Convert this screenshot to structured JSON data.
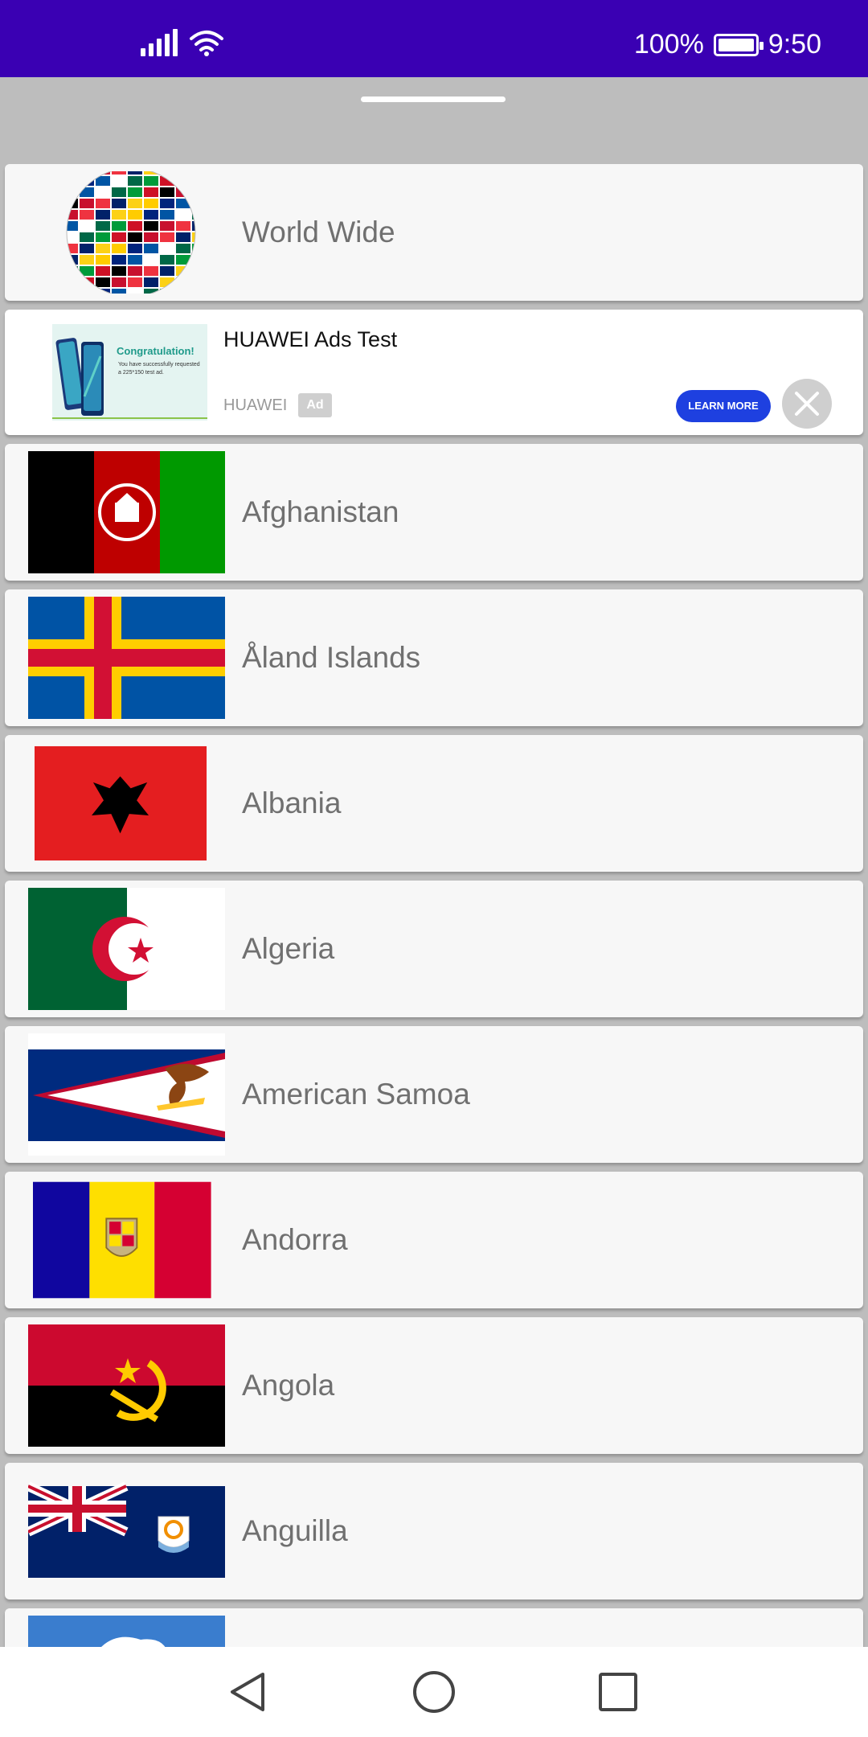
{
  "status_bar": {
    "battery_percent": "100%",
    "time": "9:50",
    "icons": [
      "signal-icon",
      "wifi-icon",
      "battery-icon"
    ],
    "background": "#3a00b3"
  },
  "list": {
    "world_wide": {
      "label": "World Wide",
      "icon": "globe-flags-icon"
    },
    "ad": {
      "title": "HUAWEI Ads Test",
      "source": "HUAWEI",
      "badge": "Ad",
      "cta": "LEARN MORE",
      "image_headline": "Congratulation!",
      "image_body": "You have successfully requested a 225*150 test ad."
    },
    "countries": [
      {
        "label": "Afghanistan"
      },
      {
        "label": "Åland Islands"
      },
      {
        "label": "Albania"
      },
      {
        "label": "Algeria"
      },
      {
        "label": "American Samoa"
      },
      {
        "label": "Andorra"
      },
      {
        "label": "Angola"
      },
      {
        "label": "Anguilla"
      },
      {
        "label": ""
      }
    ]
  },
  "nav_bar": {
    "icons": [
      "back-icon",
      "home-icon",
      "recents-icon"
    ]
  }
}
